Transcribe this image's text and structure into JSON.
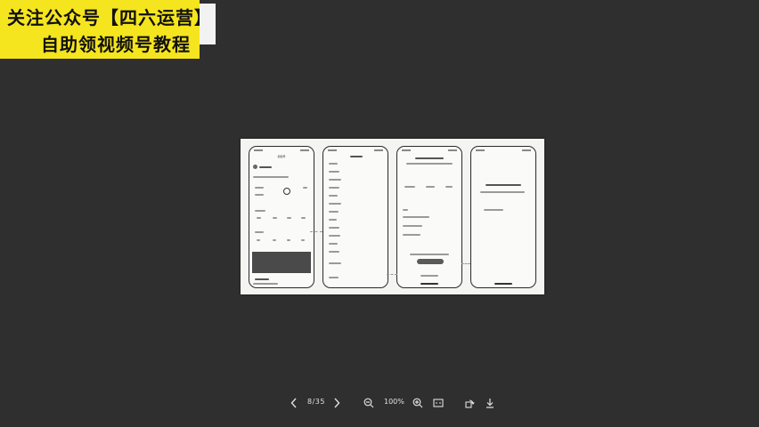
{
  "banner": {
    "line1": "关注公众号【四六运营】",
    "line2": "自助领视频号教程",
    "background": "#f5e51e"
  },
  "document": {
    "phone1_header": "视频号"
  },
  "toolbar": {
    "prev_icon": "chevron-left-icon",
    "page_indicator": "8/35",
    "next_icon": "chevron-right-icon",
    "zoom_out_icon": "zoom-out-icon",
    "zoom_level": "100%",
    "zoom_in_icon": "zoom-in-icon",
    "fit_icon": "fit-screen-icon",
    "rotate_icon": "rotate-icon",
    "download_icon": "download-icon"
  }
}
